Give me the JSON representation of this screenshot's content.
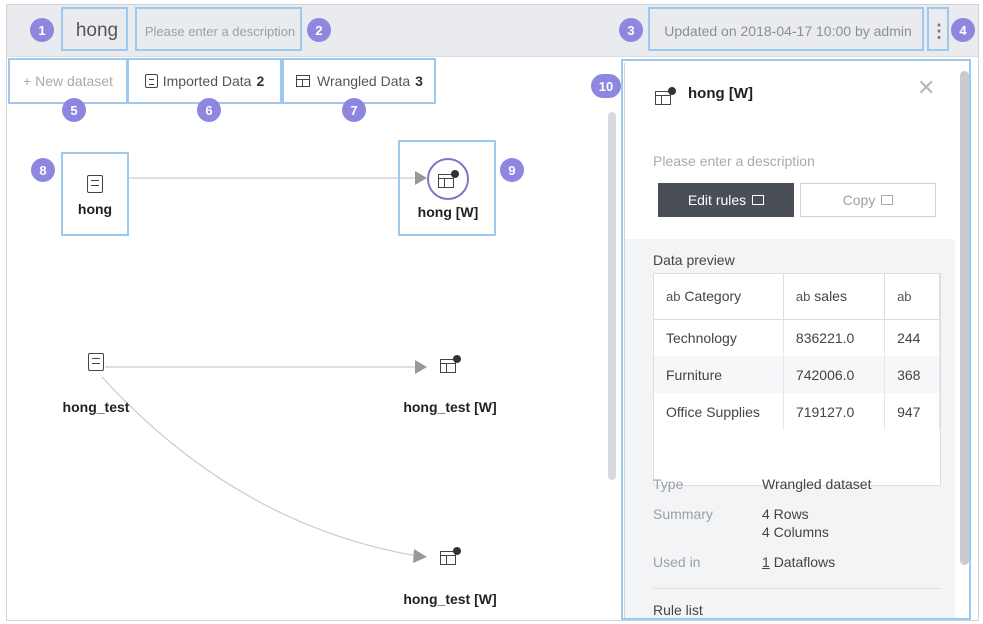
{
  "header": {
    "title": "hong",
    "description_placeholder": "Please enter a description",
    "updated": "Updated on 2018-04-17 10:00 by admin",
    "more_glyph": "⋮"
  },
  "tabs": {
    "new_dataset": "+ New dataset",
    "imported_label": "Imported Data",
    "imported_count": "2",
    "wrangled_label": "Wrangled Data",
    "wrangled_count": "3"
  },
  "nodes": [
    {
      "label": "hong",
      "type": "imported"
    },
    {
      "label": "hong [W]",
      "type": "wrangled"
    },
    {
      "label": "hong_test",
      "type": "imported"
    },
    {
      "label": "hong_test [W]",
      "type": "wrangled"
    },
    {
      "label": "hong_test [W]",
      "type": "wrangled"
    }
  ],
  "panel": {
    "title": "hong [W]",
    "close_glyph": "✕",
    "description_placeholder": "Please enter a description",
    "edit_rules_label": "Edit rules",
    "copy_label": "Copy",
    "preview_title": "Data preview",
    "columns": [
      {
        "type": "ab",
        "name": "Category"
      },
      {
        "type": "ab",
        "name": "sales"
      },
      {
        "type": "ab",
        "name": ""
      }
    ],
    "rows": [
      [
        "Technology",
        "836221.0",
        "244"
      ],
      [
        "Furniture",
        "742006.0",
        "368"
      ],
      [
        "Office Supplies",
        "719127.0",
        "947"
      ]
    ],
    "type_label": "Type",
    "type_value": "Wrangled dataset",
    "summary_label": "Summary",
    "summary_rows": "4 Rows",
    "summary_columns": "4 Columns",
    "used_in_label": "Used in",
    "used_in_count": "1",
    "used_in_text": "Dataflows",
    "rule_list_label": "Rule list"
  },
  "badges": [
    "1",
    "2",
    "3",
    "4",
    "5",
    "6",
    "7",
    "8",
    "9",
    "10"
  ],
  "colors": {
    "header_bg": "#eaebee",
    "highlight_border": "#9ec9ee",
    "badge": "#8e87e0",
    "edit_button": "#4a4e57"
  },
  "icons": {
    "dataset": "dataset-icon",
    "wrangled": "wrangled-dataset-icon",
    "edit": "window-icon",
    "copy": "window-icon"
  }
}
